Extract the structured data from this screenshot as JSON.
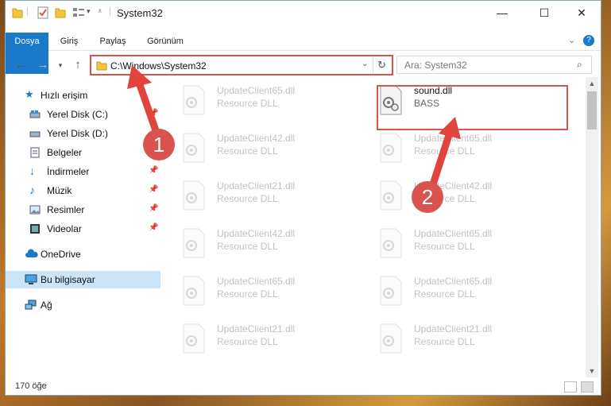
{
  "window": {
    "title": "System32"
  },
  "ribbon": {
    "tabs": [
      "Dosya",
      "Giriş",
      "Paylaş",
      "Görünüm"
    ]
  },
  "address": {
    "path": "C:\\Windows\\System32"
  },
  "search": {
    "placeholder": "Ara: System32"
  },
  "nav": {
    "items": [
      {
        "label": "Hızlı erişim",
        "icon": "star-icon"
      },
      {
        "label": "Yerel Disk (C:)",
        "icon": "drive-icon",
        "pinned": true
      },
      {
        "label": "Yerel Disk (D:)",
        "icon": "drive-icon"
      },
      {
        "label": "Belgeler",
        "icon": "document-icon",
        "pinned": true
      },
      {
        "label": "İndirmeler",
        "icon": "download-icon",
        "pinned": true
      },
      {
        "label": "Müzik",
        "icon": "music-icon",
        "pinned": true
      },
      {
        "label": "Resimler",
        "icon": "pictures-icon",
        "pinned": true
      },
      {
        "label": "Videolar",
        "icon": "video-icon",
        "pinned": true
      },
      {
        "label": "OneDrive",
        "icon": "cloud-icon"
      },
      {
        "label": "Bu bilgisayar",
        "icon": "computer-icon",
        "selected": true
      },
      {
        "label": "Ağ",
        "icon": "network-icon"
      }
    ]
  },
  "files": {
    "left": [
      {
        "name": "UpdateClient65.dll",
        "type": "Resource DLL"
      },
      {
        "name": "UpdateClient42.dll",
        "type": "Resource DLL"
      },
      {
        "name": "UpdateClient21.dll",
        "type": "Resource DLL"
      },
      {
        "name": "UpdateClient42.dll",
        "type": "Resource DLL"
      },
      {
        "name": "UpdateClient65.dll",
        "type": "Resource DLL"
      },
      {
        "name": "UpdateClient21.dll",
        "type": "Resource DLL"
      }
    ],
    "right": [
      {
        "name": "sound.dll",
        "type": "BASS",
        "highlighted": true
      },
      {
        "name": "UpdateClient65.dll",
        "type": "Resource DLL"
      },
      {
        "name": "UpdateClient42.dll",
        "type": "Resource DLL"
      },
      {
        "name": "UpdateClient65.dll",
        "type": "Resource DLL"
      },
      {
        "name": "UpdateClient65.dll",
        "type": "Resource DLL"
      },
      {
        "name": "UpdateClient21.dll",
        "type": "Resource DLL"
      }
    ]
  },
  "status": {
    "item_count": "170 öğe"
  },
  "callouts": {
    "step1": "1",
    "step2": "2"
  },
  "colors": {
    "accent": "#1979ca",
    "highlight": "#d9534f",
    "selected": "#cce4f7"
  }
}
